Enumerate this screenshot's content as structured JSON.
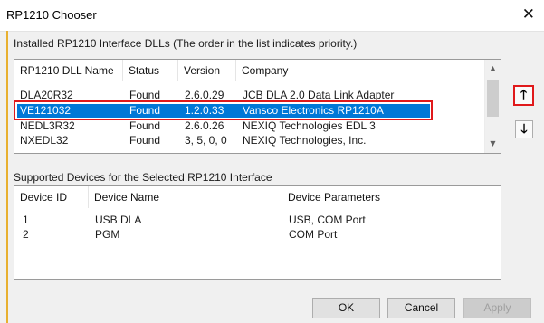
{
  "window": {
    "title": "RP1210 Chooser"
  },
  "dll_section": {
    "label": "Installed RP1210 Interface DLLs  (The order in the list indicates priority.)",
    "columns": [
      "RP1210 DLL Name",
      "Status",
      "Version",
      "Company"
    ],
    "rows": [
      [
        "DLA20R32",
        "Found",
        "2.6.0.29",
        "JCB DLA 2.0 Data Link Adapter"
      ],
      [
        "VE121032",
        "Found",
        "1.2.0.33",
        "Vansco Electronics RP1210A"
      ],
      [
        "NEDL3R32",
        "Found",
        "2.6.0.26",
        "NEXIQ Technologies EDL 3"
      ],
      [
        "NXEDL32",
        "Found",
        "3, 5, 0, 0",
        "NEXIQ Technologies, Inc."
      ]
    ],
    "selected_index": 1
  },
  "device_section": {
    "label": "Supported Devices for the Selected RP1210 Interface",
    "columns": [
      "Device ID",
      "Device Name",
      "Device Parameters"
    ],
    "rows": [
      [
        "1",
        "USB DLA",
        "USB, COM Port"
      ],
      [
        "2",
        "PGM",
        "COM Port"
      ]
    ]
  },
  "move_buttons": {
    "up_icon": "arrow-up",
    "down_icon": "arrow-down",
    "up_glyph": "🡑",
    "down_glyph": "🡓"
  },
  "buttons": {
    "ok": "OK",
    "cancel": "Cancel",
    "apply": "Apply"
  },
  "colors": {
    "selection": "#0078d7",
    "highlight_outline": "#e0191b"
  }
}
